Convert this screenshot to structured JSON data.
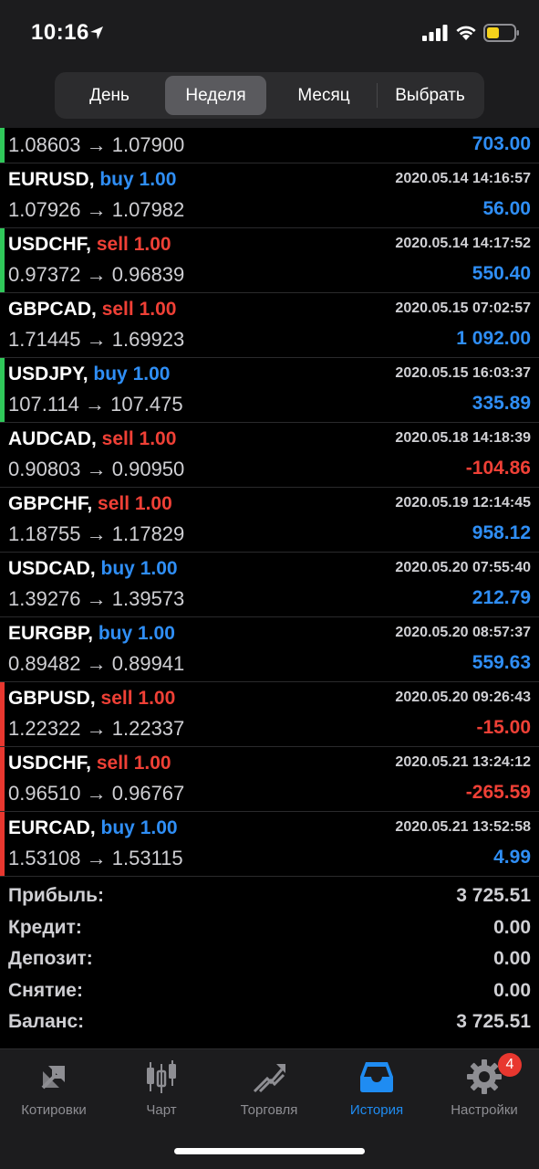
{
  "status": {
    "time": "10:16"
  },
  "periods": {
    "day": "День",
    "week": "Неделя",
    "month": "Месяц",
    "custom": "Выбрать"
  },
  "deals": [
    {
      "symbol": "",
      "side": "",
      "sep": "",
      "volume": "",
      "time": "",
      "prices": "1.08603 → 1.07900",
      "profit": "703.00",
      "profit_sign": "pos",
      "bar": "green",
      "first": true
    },
    {
      "symbol": "EURUSD",
      "sep": ", ",
      "side": "buy",
      "volume": "1.00",
      "time": "2020.05.14 14:16:57",
      "prices": "1.07926 → 1.07982",
      "profit": "56.00",
      "profit_sign": "pos",
      "bar": "none"
    },
    {
      "symbol": "USDCHF",
      "sep": ", ",
      "side": "sell",
      "volume": "1.00",
      "time": "2020.05.14 14:17:52",
      "prices": "0.97372 → 0.96839",
      "profit": "550.40",
      "profit_sign": "pos",
      "bar": "green"
    },
    {
      "symbol": "GBPCAD",
      "sep": ", ",
      "side": "sell",
      "volume": "1.00",
      "time": "2020.05.15 07:02:57",
      "prices": "1.71445 → 1.69923",
      "profit": "1 092.00",
      "profit_sign": "pos",
      "bar": "none"
    },
    {
      "symbol": "USDJPY",
      "sep": ", ",
      "side": "buy",
      "volume": "1.00",
      "time": "2020.05.15 16:03:37",
      "prices": "107.114 → 107.475",
      "profit": "335.89",
      "profit_sign": "pos",
      "bar": "green"
    },
    {
      "symbol": "AUDCAD",
      "sep": ", ",
      "side": "sell",
      "volume": "1.00",
      "time": "2020.05.18 14:18:39",
      "prices": "0.90803 → 0.90950",
      "profit": "-104.86",
      "profit_sign": "neg",
      "bar": "none"
    },
    {
      "symbol": "GBPCHF",
      "sep": ", ",
      "side": "sell",
      "volume": "1.00",
      "time": "2020.05.19 12:14:45",
      "prices": "1.18755 → 1.17829",
      "profit": "958.12",
      "profit_sign": "pos",
      "bar": "none"
    },
    {
      "symbol": "USDCAD",
      "sep": ", ",
      "side": "buy",
      "volume": "1.00",
      "time": "2020.05.20 07:55:40",
      "prices": "1.39276 → 1.39573",
      "profit": "212.79",
      "profit_sign": "pos",
      "bar": "none"
    },
    {
      "symbol": "EURGBP",
      "sep": ", ",
      "side": "buy",
      "volume": "1.00",
      "time": "2020.05.20 08:57:37",
      "prices": "0.89482 → 0.89941",
      "profit": "559.63",
      "profit_sign": "pos",
      "bar": "none"
    },
    {
      "symbol": "GBPUSD",
      "sep": ", ",
      "side": "sell",
      "volume": "1.00",
      "time": "2020.05.20 09:26:43",
      "prices": "1.22322 → 1.22337",
      "profit": "-15.00",
      "profit_sign": "neg",
      "bar": "red"
    },
    {
      "symbol": "USDCHF",
      "sep": ", ",
      "side": "sell",
      "volume": "1.00",
      "time": "2020.05.21 13:24:12",
      "prices": "0.96510 → 0.96767",
      "profit": "-265.59",
      "profit_sign": "neg",
      "bar": "red"
    },
    {
      "symbol": "EURCAD",
      "sep": ", ",
      "side": "buy",
      "volume": "1.00",
      "time": "2020.05.21 13:52:58",
      "prices": "1.53108 → 1.53115",
      "profit": "4.99",
      "profit_sign": "pos",
      "bar": "red"
    }
  ],
  "summary": [
    {
      "label": "Прибыль:",
      "value": "3 725.51"
    },
    {
      "label": "Кредит:",
      "value": "0.00"
    },
    {
      "label": "Депозит:",
      "value": "0.00"
    },
    {
      "label": "Снятие:",
      "value": "0.00"
    },
    {
      "label": "Баланс:",
      "value": "3 725.51"
    }
  ],
  "tabs": [
    {
      "label": "Котировки",
      "icon": "quotes-icon"
    },
    {
      "label": "Чарт",
      "icon": "candlestick-chart-icon"
    },
    {
      "label": "Торговля",
      "icon": "trade-icon"
    },
    {
      "label": "История",
      "icon": "history-inbox-icon",
      "active": true
    },
    {
      "label": "Настройки",
      "icon": "gear-icon",
      "badge": "4"
    }
  ],
  "colors": {
    "buy": "#2f8ef5",
    "sell": "#ef4036",
    "profit_bar": "#30c85a",
    "loss_bar": "#e8372f",
    "active_tab": "#1f8cf2"
  }
}
